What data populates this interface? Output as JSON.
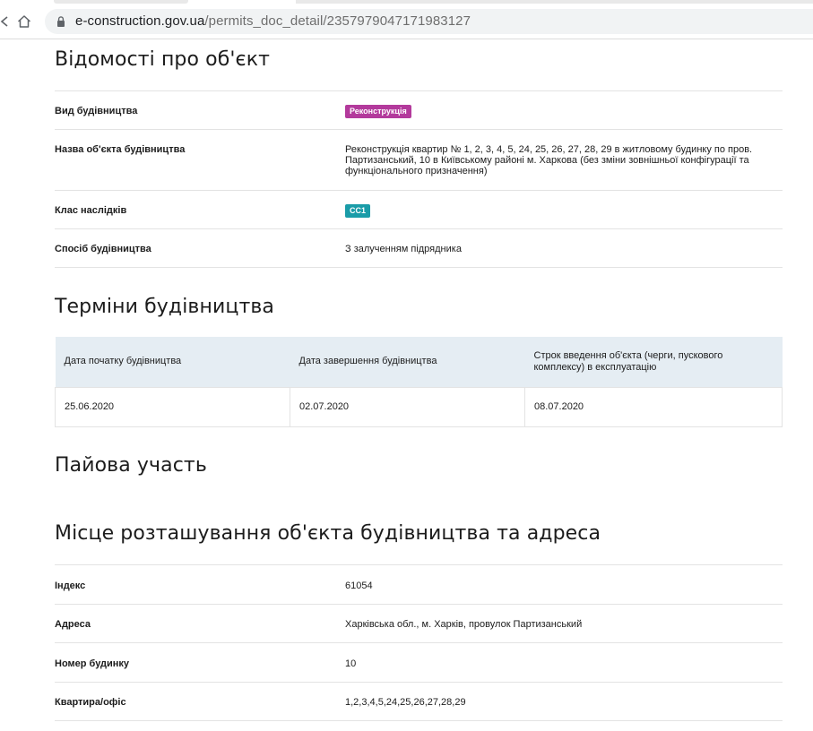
{
  "browser": {
    "url_host": "e-construction.gov.ua",
    "url_path": "/permits_doc_detail/2357979047171983127"
  },
  "object_info": {
    "title": "Відомості про об'єкт",
    "rows": [
      {
        "label": "Вид будівництва",
        "badge": "Реконструкція",
        "badge_color": "#b33a9c"
      },
      {
        "label": "Назва об'єкта будівництва",
        "value": "Реконструкція квартир № 1, 2, 3, 4, 5, 24, 25, 26, 27, 28, 29 в житловому будинку по пров. Партизанський, 10 в Київському районі м. Харкова (без зміни зовнішньої конфігурації та функціонального призначення)"
      },
      {
        "label": "Клас наслідків",
        "badge": "СС1",
        "badge_color": "#1a9ca8"
      },
      {
        "label": "Спосіб будівництва",
        "value": "З залученням підрядника"
      }
    ]
  },
  "terms": {
    "title": "Терміни будівництва",
    "headers": [
      "Дата початку будівництва",
      "Дата завершення будівництва",
      "Строк введення об'єкта (черги, пускового комплексу) в експлуатацію"
    ],
    "values": [
      "25.06.2020",
      "02.07.2020",
      "08.07.2020"
    ]
  },
  "share": {
    "title": "Пайова участь"
  },
  "location": {
    "title": "Місце розташування об'єкта будівництва та адреса",
    "rows": [
      {
        "label": "Індекс",
        "value": "61054"
      },
      {
        "label": "Адреса",
        "value": "Харківська обл., м. Харків, провулок Партизанський"
      },
      {
        "label": "Номер будинку",
        "value": "10"
      },
      {
        "label": "Квартира/офіс",
        "value": "1,2,3,4,5,24,25,26,27,28,29"
      }
    ]
  }
}
